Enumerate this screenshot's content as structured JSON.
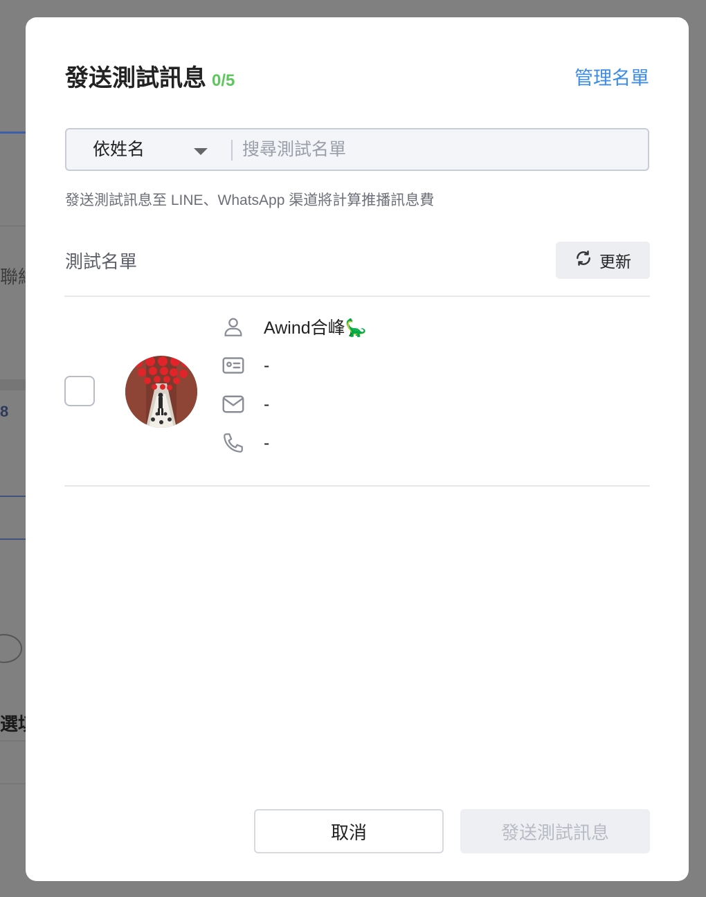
{
  "background": {
    "fragments": [
      "聯絡",
      "8",
      "選填"
    ]
  },
  "dialog": {
    "title": "發送測試訊息",
    "count": "0/5",
    "manage_link": "管理名單",
    "search": {
      "filter_value": "依姓名",
      "placeholder": "搜尋測試名單"
    },
    "notice": "發送測試訊息至 LINE、WhatsApp 渠道將計算推播訊息費",
    "list_label": "測試名單",
    "refresh_label": "更新",
    "contacts": [
      {
        "name": "Awind合峰🦕",
        "id_value": "-",
        "email": "-",
        "phone": "-"
      }
    ],
    "cancel_label": "取消",
    "send_label": "發送測試訊息"
  },
  "colors": {
    "accent": "#3c8ce7",
    "count_green": "#5cc85c",
    "overlay": "#808080"
  }
}
